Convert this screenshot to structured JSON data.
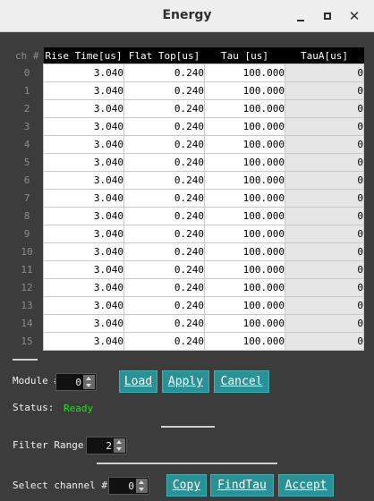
{
  "window": {
    "title": "Energy"
  },
  "table": {
    "ch_header": "ch #",
    "headers": [
      "Rise Time[us]",
      "Flat Top[us]",
      "Tau [us]",
      "TauA[us]"
    ],
    "rows": [
      {
        "ch": "0",
        "rise": "3.040",
        "flat": "0.240",
        "tau": "100.000",
        "taua": "0"
      },
      {
        "ch": "1",
        "rise": "3.040",
        "flat": "0.240",
        "tau": "100.000",
        "taua": "0"
      },
      {
        "ch": "2",
        "rise": "3.040",
        "flat": "0.240",
        "tau": "100.000",
        "taua": "0"
      },
      {
        "ch": "3",
        "rise": "3.040",
        "flat": "0.240",
        "tau": "100.000",
        "taua": "0"
      },
      {
        "ch": "4",
        "rise": "3.040",
        "flat": "0.240",
        "tau": "100.000",
        "taua": "0"
      },
      {
        "ch": "5",
        "rise": "3.040",
        "flat": "0.240",
        "tau": "100.000",
        "taua": "0"
      },
      {
        "ch": "6",
        "rise": "3.040",
        "flat": "0.240",
        "tau": "100.000",
        "taua": "0"
      },
      {
        "ch": "7",
        "rise": "3.040",
        "flat": "0.240",
        "tau": "100.000",
        "taua": "0"
      },
      {
        "ch": "8",
        "rise": "3.040",
        "flat": "0.240",
        "tau": "100.000",
        "taua": "0"
      },
      {
        "ch": "9",
        "rise": "3.040",
        "flat": "0.240",
        "tau": "100.000",
        "taua": "0"
      },
      {
        "ch": "10",
        "rise": "3.040",
        "flat": "0.240",
        "tau": "100.000",
        "taua": "0"
      },
      {
        "ch": "11",
        "rise": "3.040",
        "flat": "0.240",
        "tau": "100.000",
        "taua": "0"
      },
      {
        "ch": "12",
        "rise": "3.040",
        "flat": "0.240",
        "tau": "100.000",
        "taua": "0"
      },
      {
        "ch": "13",
        "rise": "3.040",
        "flat": "0.240",
        "tau": "100.000",
        "taua": "0"
      },
      {
        "ch": "14",
        "rise": "3.040",
        "flat": "0.240",
        "tau": "100.000",
        "taua": "0"
      },
      {
        "ch": "15",
        "rise": "3.040",
        "flat": "0.240",
        "tau": "100.000",
        "taua": "0"
      }
    ]
  },
  "module": {
    "label": "Module #",
    "value": "0"
  },
  "buttons": {
    "load": "Load",
    "apply": "Apply",
    "cancel": "Cancel",
    "copy": "Copy",
    "findtau": "FindTau",
    "accept": "Accept"
  },
  "status": {
    "label": "Status:",
    "value": "Ready"
  },
  "filter": {
    "label": "Filter Range",
    "value": "2"
  },
  "select_channel": {
    "label": "Select channel #",
    "value": "0"
  },
  "colors": {
    "accent": "#2a9296",
    "ready": "#22dd22",
    "background": "#3c3c3c"
  }
}
